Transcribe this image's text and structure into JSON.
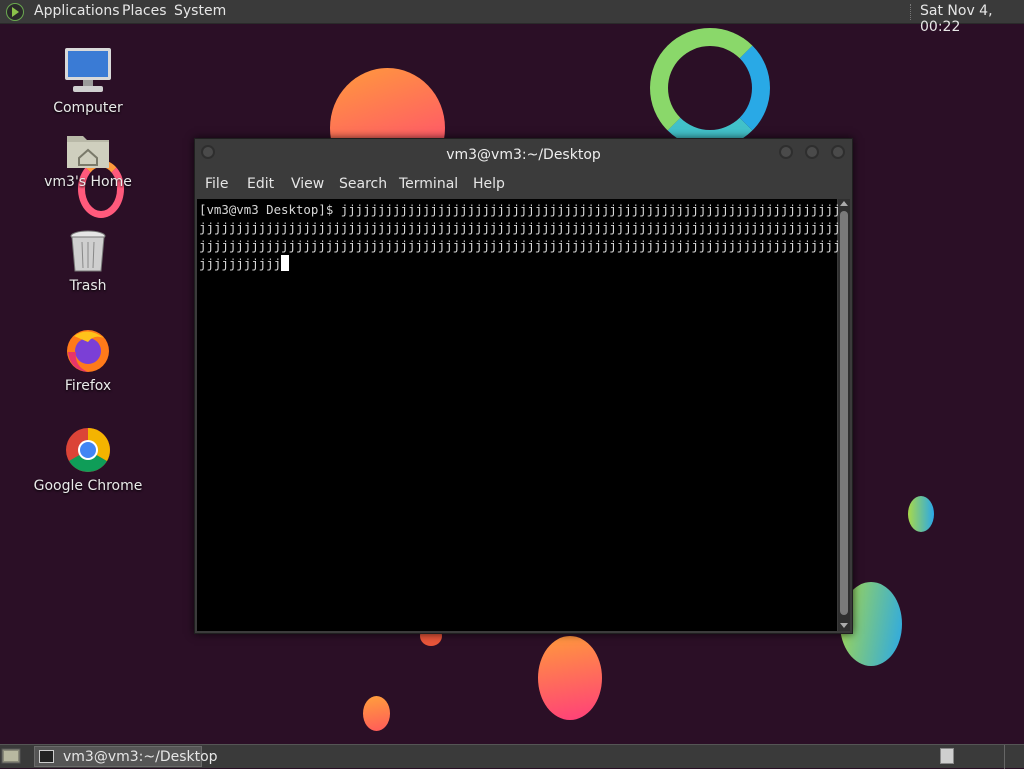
{
  "top_panel": {
    "menus": [
      "Applications",
      "Places",
      "System"
    ],
    "clock": "Sat Nov  4, 00:22"
  },
  "desktop_icons": [
    {
      "label": "Computer",
      "icon": "computer-icon"
    },
    {
      "label": "vm3's Home",
      "icon": "home-folder-icon"
    },
    {
      "label": "Trash",
      "icon": "trash-icon"
    },
    {
      "label": "Firefox",
      "icon": "firefox-icon"
    },
    {
      "label": "Google Chrome",
      "icon": "chrome-icon"
    }
  ],
  "terminal": {
    "title": "vm3@vm3:~/Desktop",
    "menu": [
      "File",
      "Edit",
      "View",
      "Search",
      "Terminal",
      "Help"
    ],
    "prompt": "[vm3@vm3 Desktop]$ ",
    "typed": "jjjjjjjjjjjjjjjjjjjjjjjjjjjjjjjjjjjjjjjjjjjjjjjjjjjjjjjjjjjjjjjjjjjjjjjjjjjjjjjjjjjjjjjjjjjjjjjjjjjjjjjjjjjjjjjjjjjjjjjjjjjjjjjjjjjjjjjjjjjjjjjjjjjjjjjjjjjjjjjjjjjjjjjjjjjjjjjjjjjjjjjjjjjjjjjjjjjjjjjjjjjjjjjjjjjjjjjjjjjjjjjjjjjjjjjjjjjjjjjjjjjjjjjjjj"
  },
  "taskbar": {
    "window_label": "vm3@vm3:~/Desktop"
  },
  "colors": {
    "panel": "#3a3a3a",
    "terminal_bg": "#000000",
    "terminal_fg": "#d8d8d8",
    "desktop_bg": "#2b0f26"
  }
}
